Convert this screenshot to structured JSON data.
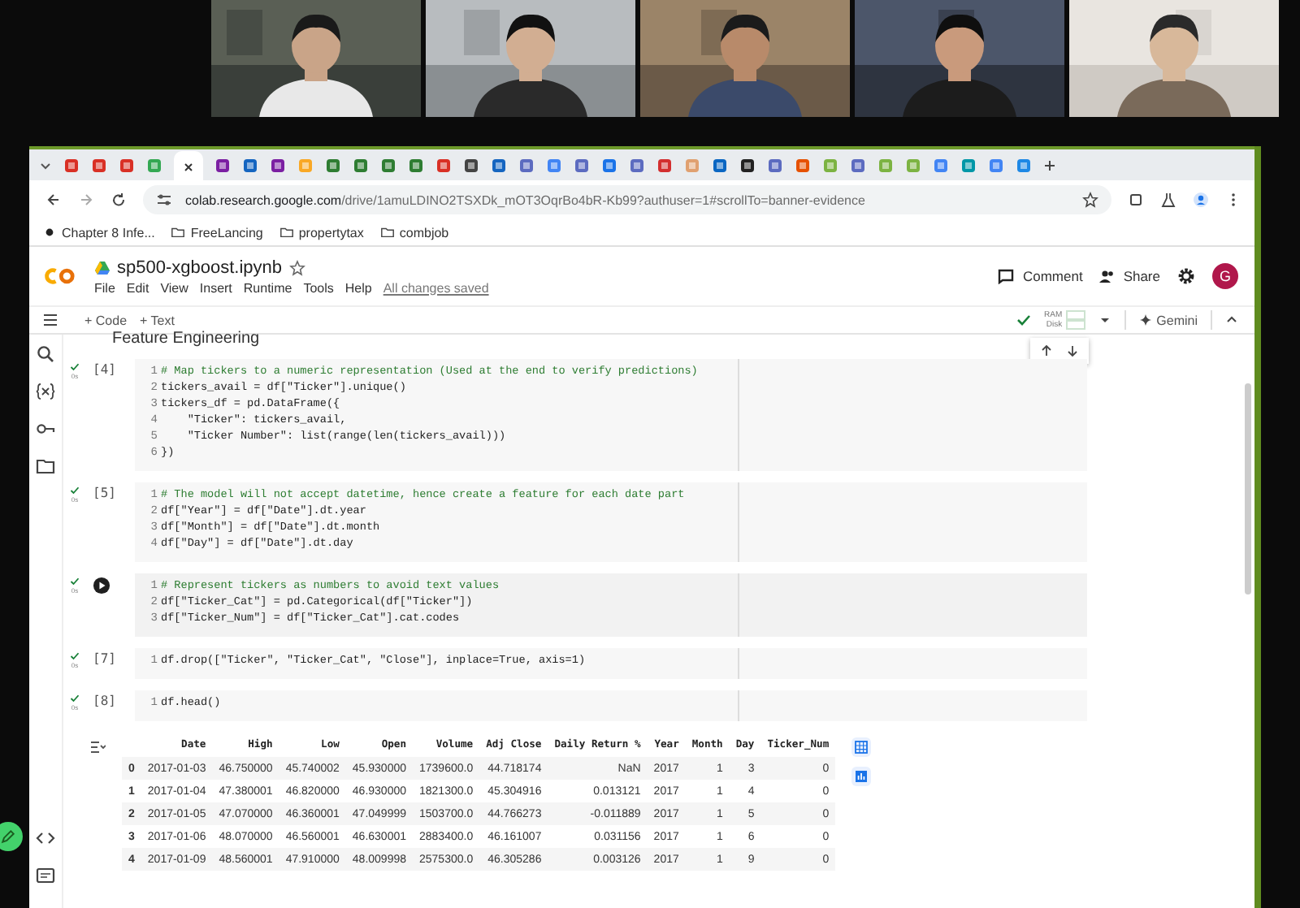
{
  "browser": {
    "url_host": "colab.research.google.com",
    "url_path": "/drive/1amuLDINO2TSXDk_mOT3OqrBo4bR-Kb99?authuser=1#scrollTo=banner-evidence",
    "bookmarks": [
      {
        "label": "Chapter 8 Infe...",
        "kind": "page"
      },
      {
        "label": "FreeLancing",
        "kind": "folder"
      },
      {
        "label": "propertytax",
        "kind": "folder"
      },
      {
        "label": "combjob",
        "kind": "folder"
      }
    ]
  },
  "notebook": {
    "title": "sp500-xgboost.ipynb",
    "menu": [
      "File",
      "Edit",
      "View",
      "Insert",
      "Runtime",
      "Tools",
      "Help"
    ],
    "save_status": "All changes saved",
    "comment": "Comment",
    "share": "Share",
    "avatar": "G",
    "add_buttons": [
      "+ Code",
      "+ Text"
    ],
    "resources": [
      "RAM",
      "Disk"
    ],
    "gemini": "Gemini",
    "heading": "Feature Engineering"
  },
  "cells": [
    {
      "kind": "ran",
      "count": "[4]",
      "time": "0s",
      "lines": [
        {
          "n": "1",
          "text": "# Map tickers to a numeric representation (Used at the end to verify predictions)",
          "kind": "comment"
        },
        {
          "n": "2",
          "text": "tickers_avail = df[\"Ticker\"].unique()",
          "kind": "code"
        },
        {
          "n": "3",
          "text": "tickers_df = pd.DataFrame({",
          "kind": "code"
        },
        {
          "n": "4",
          "text": "    \"Ticker\": tickers_avail,",
          "kind": "code"
        },
        {
          "n": "5",
          "text": "    \"Ticker Number\": list(range(len(tickers_avail)))",
          "kind": "code"
        },
        {
          "n": "6",
          "text": "})",
          "kind": "code"
        }
      ]
    },
    {
      "kind": "ran",
      "count": "[5]",
      "time": "0s",
      "lines": [
        {
          "n": "1",
          "text": "# The model will not accept datetime, hence create a feature for each date part",
          "kind": "comment"
        },
        {
          "n": "2",
          "text": "df[\"Year\"] = df[\"Date\"].dt.year",
          "kind": "code"
        },
        {
          "n": "3",
          "text": "df[\"Month\"] = df[\"Date\"].dt.month",
          "kind": "code"
        },
        {
          "n": "4",
          "text": "df[\"Day\"] = df[\"Date\"].dt.day",
          "kind": "code"
        }
      ]
    },
    {
      "kind": "focused",
      "time": "0s",
      "lines": [
        {
          "n": "1",
          "text": "# Represent tickers as numbers to avoid text values",
          "kind": "comment"
        },
        {
          "n": "2",
          "text": "df[\"Ticker_Cat\"] = pd.Categorical(df[\"Ticker\"])",
          "kind": "code"
        },
        {
          "n": "3",
          "text": "df[\"Ticker_Num\"] = df[\"Ticker_Cat\"].cat.codes",
          "kind": "code"
        }
      ]
    },
    {
      "kind": "ran",
      "count": "[7]",
      "time": "0s",
      "lines": [
        {
          "n": "1",
          "text": "df.drop([\"Ticker\", \"Ticker_Cat\", \"Close\"], inplace=True, axis=1)",
          "kind": "code"
        }
      ]
    },
    {
      "kind": "ran",
      "count": "[8]",
      "time": "0s",
      "lines": [
        {
          "n": "1",
          "text": "df.head()",
          "kind": "code"
        }
      ]
    }
  ],
  "output": {
    "columns": [
      "Date",
      "High",
      "Low",
      "Open",
      "Volume",
      "Adj Close",
      "Daily Return %",
      "Year",
      "Month",
      "Day",
      "Ticker_Num"
    ],
    "rows": [
      {
        "index": "0",
        "cells": [
          "2017-01-03",
          "46.750000",
          "45.740002",
          "45.930000",
          "1739600.0",
          "44.718174",
          "NaN",
          "2017",
          "1",
          "3",
          "0"
        ]
      },
      {
        "index": "1",
        "cells": [
          "2017-01-04",
          "47.380001",
          "46.820000",
          "46.930000",
          "1821300.0",
          "45.304916",
          "0.013121",
          "2017",
          "1",
          "4",
          "0"
        ]
      },
      {
        "index": "2",
        "cells": [
          "2017-01-05",
          "47.070000",
          "46.360001",
          "47.049999",
          "1503700.0",
          "44.766273",
          "-0.011889",
          "2017",
          "1",
          "5",
          "0"
        ]
      },
      {
        "index": "3",
        "cells": [
          "2017-01-06",
          "48.070000",
          "46.560001",
          "46.630001",
          "2883400.0",
          "46.161007",
          "0.031156",
          "2017",
          "1",
          "6",
          "0"
        ]
      },
      {
        "index": "4",
        "cells": [
          "2017-01-09",
          "48.560001",
          "47.910000",
          "48.009998",
          "2575300.0",
          "46.305286",
          "0.003126",
          "2017",
          "1",
          "9",
          "0"
        ]
      }
    ]
  }
}
